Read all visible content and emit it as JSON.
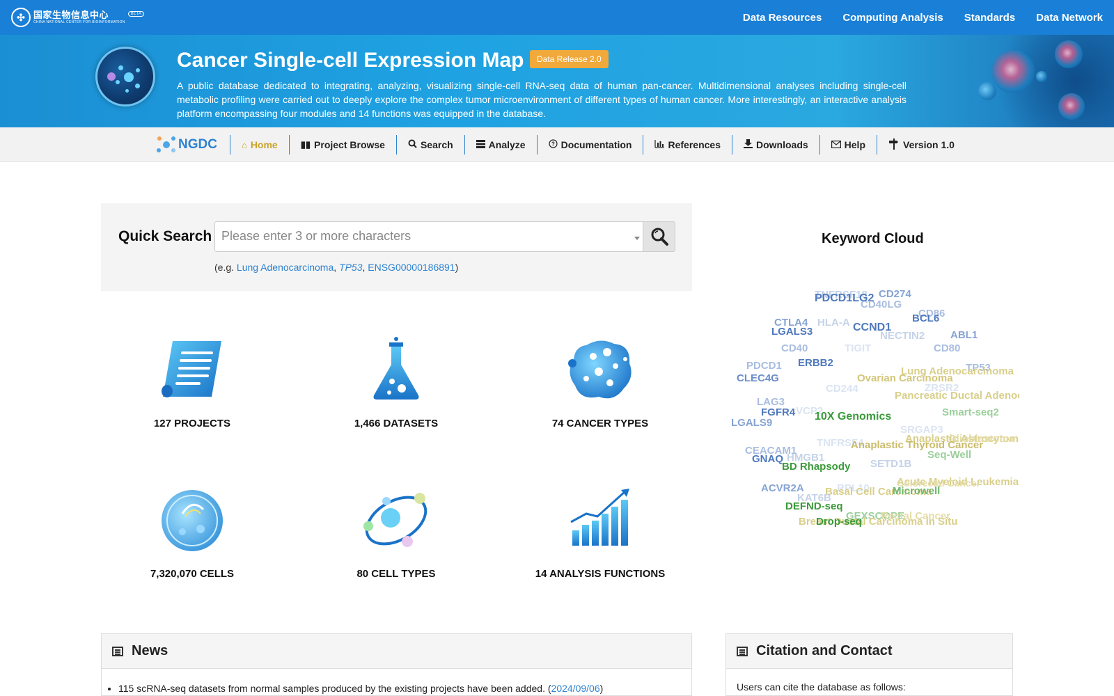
{
  "topbar": {
    "logo_cn": "国家生物信息中心",
    "logo_en": "CHINA NATIONAL CENTER FOR BIOINFORMATION",
    "logo_badge": "BETA",
    "nav": [
      "Data Resources",
      "Computing Analysis",
      "Standards",
      "Data Network"
    ]
  },
  "banner": {
    "title": "Cancer Single-cell Expression Map",
    "release": "Data Release 2.0",
    "description": "A public database dedicated to integrating, analyzing, visualizing single-cell RNA-seq data of human pan-cancer. Multidimensional analyses including single-cell metabolic profiling were carried out to deeply explore the complex tumor microenvironment of different types of human cancer. More interestingly, an interactive analysis platform encompassing four modules and 14 functions was equipped in the database."
  },
  "navbar": {
    "brand": "NGDC",
    "items": [
      {
        "label": "Home",
        "icon": "home-icon"
      },
      {
        "label": "Project Browse",
        "icon": "book-icon"
      },
      {
        "label": "Search",
        "icon": "search-icon"
      },
      {
        "label": "Analyze",
        "icon": "list-icon"
      },
      {
        "label": "Documentation",
        "icon": "question-icon"
      },
      {
        "label": "References",
        "icon": "bar-chart-icon"
      },
      {
        "label": "Downloads",
        "icon": "download-icon"
      },
      {
        "label": "Help",
        "icon": "envelope-icon"
      },
      {
        "label": "Version 1.0",
        "icon": "signpost-icon"
      }
    ]
  },
  "quick_search": {
    "label": "Quick Search",
    "placeholder": "Please enter 3 or more characters",
    "example_prefix": "(e.g. ",
    "example_1": "Lung Adenocarcinoma",
    "example_2": "TP53",
    "example_3": "ENSG00000186891",
    "example_suffix": ")"
  },
  "stats": [
    {
      "label": "127 PROJECTS",
      "icon": "scroll-icon"
    },
    {
      "label": "1,466 DATASETS",
      "icon": "flask-icon"
    },
    {
      "label": "74 CANCER TYPES",
      "icon": "cancer-cell-icon"
    },
    {
      "label": "7,320,070 CELLS",
      "icon": "cell-icon"
    },
    {
      "label": "80 CELL TYPES",
      "icon": "cell-types-icon"
    },
    {
      "label": "14 ANALYSIS FUNCTIONS",
      "icon": "growth-chart-icon"
    }
  ],
  "keyword_cloud": {
    "title": "Keyword Cloud",
    "words": [
      {
        "t": "TNFRSF18",
        "c": "#c5d3e8"
      },
      {
        "t": "PDCD1LG2",
        "c": "#4f79bd"
      },
      {
        "t": "CD274",
        "c": "#86a3d3"
      },
      {
        "t": "CD40LG",
        "c": "#a9bde0"
      },
      {
        "t": "CD86",
        "c": "#a9bde0"
      },
      {
        "t": "BCL6",
        "c": "#4f79bd"
      },
      {
        "t": "CTLA4",
        "c": "#86a3d3"
      },
      {
        "t": "HLA-A",
        "c": "#c5d3e8"
      },
      {
        "t": "CCND1",
        "c": "#4f79bd"
      },
      {
        "t": "LGALS3",
        "c": "#4f79bd"
      },
      {
        "t": "NECTIN2",
        "c": "#c5d3e8"
      },
      {
        "t": "ABL1",
        "c": "#86a3d3"
      },
      {
        "t": "CD40",
        "c": "#a9bde0"
      },
      {
        "t": "TIGIT",
        "c": "#dbe4f2"
      },
      {
        "t": "CD80",
        "c": "#a9bde0"
      },
      {
        "t": "PDCD1",
        "c": "#a9bde0"
      },
      {
        "t": "ERBB2",
        "c": "#4f79bd"
      },
      {
        "t": "TP53",
        "c": "#a9bde0"
      },
      {
        "t": "Lung Adenocarcinoma",
        "c": "#d9cf8a"
      },
      {
        "t": "CLEC4G",
        "c": "#6b8dc8"
      },
      {
        "t": "Ovarian Carcinoma",
        "c": "#d2c67a"
      },
      {
        "t": "ZRSR2",
        "c": "#dbe4f2"
      },
      {
        "t": "CD244",
        "c": "#dbe4f2"
      },
      {
        "t": "Pancreatic Ductal Adenocarcinoma",
        "c": "#d9cf8a"
      },
      {
        "t": "LAG3",
        "c": "#a9bde0"
      },
      {
        "t": "VCP2",
        "c": "#dbe4f2"
      },
      {
        "t": "FGFR4",
        "c": "#4f79bd"
      },
      {
        "t": "10X Genomics",
        "c": "#3a9a3a"
      },
      {
        "t": "Smart-seq2",
        "c": "#9ccf9c"
      },
      {
        "t": "LGALS9",
        "c": "#86a3d3"
      },
      {
        "t": "SRGAP3",
        "c": "#dbe4f2"
      },
      {
        "t": "Anaplastic Astrocytoma",
        "c": "#d9cf8a"
      },
      {
        "t": "Glioblastoma",
        "c": "#e4dca8"
      },
      {
        "t": "TNFRSF4",
        "c": "#dbe4f2"
      },
      {
        "t": "Anaplastic Thyroid Cancer",
        "c": "#c9bb6a"
      },
      {
        "t": "CEACAM1",
        "c": "#a9bde0"
      },
      {
        "t": "HMGB1",
        "c": "#c5d3e8"
      },
      {
        "t": "Seq-Well",
        "c": "#9ccf9c"
      },
      {
        "t": "GNAQ",
        "c": "#4f79bd"
      },
      {
        "t": "BD Rhapsody",
        "c": "#3a9a3a"
      },
      {
        "t": "SETD1B",
        "c": "#c5d3e8"
      },
      {
        "t": "Acute Myeloid Leukemia",
        "c": "#d9cf8a"
      },
      {
        "t": "Colorectal Cancer",
        "c": "#e4dca8"
      },
      {
        "t": "ACVR2A",
        "c": "#86a3d3"
      },
      {
        "t": "RPL10",
        "c": "#dbe4f2"
      },
      {
        "t": "Basal Cell Carcinoma",
        "c": "#d9cf8a"
      },
      {
        "t": "Microwell",
        "c": "#6fb86f"
      },
      {
        "t": "KAT6B",
        "c": "#c5d3e8"
      },
      {
        "t": "DEFND-seq",
        "c": "#3a9a3a"
      },
      {
        "t": "GEXSCOPE",
        "c": "#9ccf9c"
      },
      {
        "t": "Rectal Cancer",
        "c": "#e4dca8"
      },
      {
        "t": "Breast Ductal Carcinoma in Situ",
        "c": "#d9cf8a"
      },
      {
        "t": "Drop-seq",
        "c": "#3a9a3a"
      }
    ]
  },
  "news": {
    "title": "News",
    "item_text": "115 scRNA-seq datasets from normal samples produced by the existing projects have been added. (",
    "item_date": "2024/09/06",
    "item_suffix": ")"
  },
  "citation": {
    "title": "Citation and Contact",
    "text": "Users can cite the database as follows:"
  }
}
